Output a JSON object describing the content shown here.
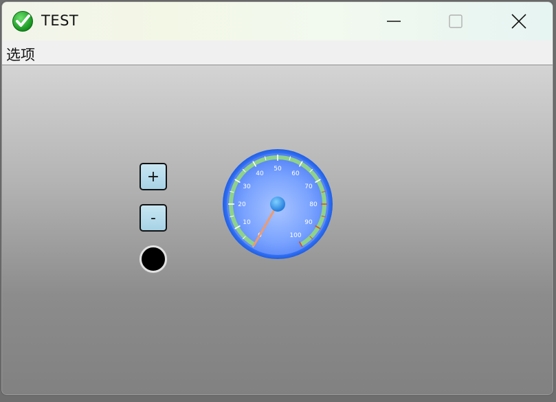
{
  "window": {
    "title": "TEST",
    "app_icon": "green-check-icon",
    "controls": {
      "minimize_icon": "minimize-icon",
      "maximize_icon": "maximize-icon",
      "close_icon": "close-icon"
    }
  },
  "menubar": {
    "items": [
      {
        "label": "选项"
      }
    ]
  },
  "controls": {
    "increase_label": "+",
    "decrease_label": "-",
    "indicator_color": "#000000"
  },
  "gauge": {
    "ticks": [
      "0",
      "10",
      "20",
      "30",
      "40",
      "50",
      "60",
      "70",
      "80",
      "90",
      "100"
    ],
    "min": 0,
    "max": 100,
    "value": 0,
    "colors": {
      "face": "#6f9bff",
      "rim": "#2f6cf0",
      "band": "#8fd28a",
      "band_warn": "#e04a20",
      "needle": "#f09a6a",
      "hub": "#2a8ce8"
    }
  }
}
